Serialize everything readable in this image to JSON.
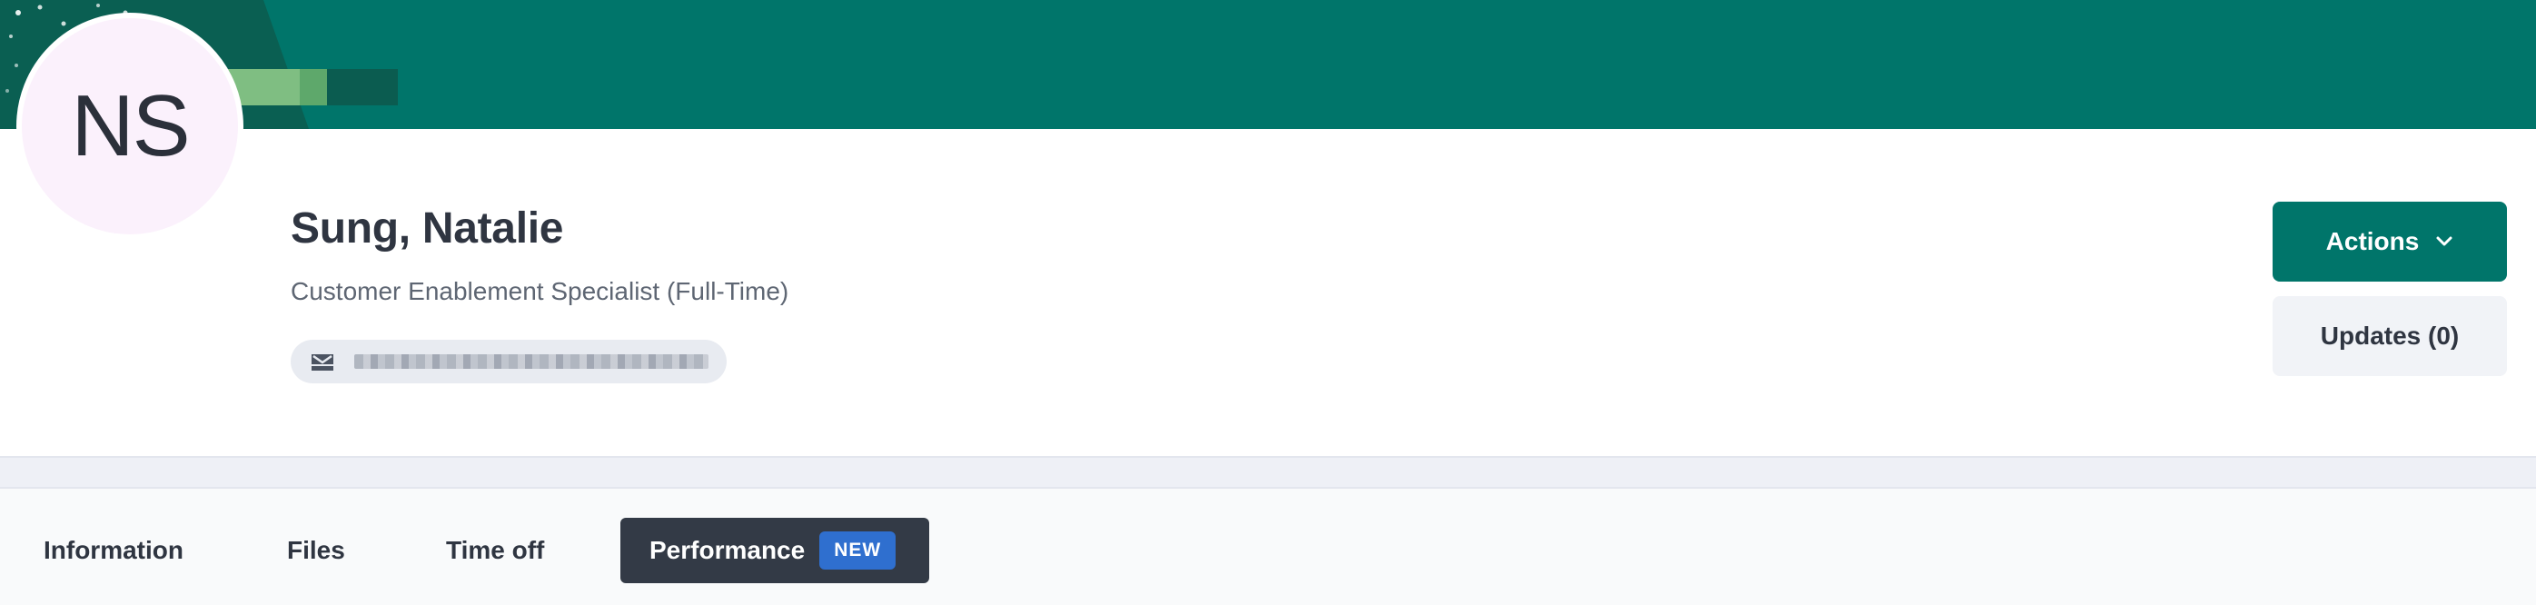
{
  "profile": {
    "initials": "NS",
    "name": "Sung, Natalie",
    "job_title": "Customer Enablement Specialist (Full-Time)",
    "email_icon": "mail-icon"
  },
  "header_actions": {
    "actions_label": "Actions",
    "actions_icon": "chevron-down-icon",
    "updates_label": "Updates (0)"
  },
  "tabs": [
    {
      "label": "Information",
      "active": false
    },
    {
      "label": "Files",
      "active": false
    },
    {
      "label": "Time off",
      "active": false
    },
    {
      "label": "Performance",
      "active": true,
      "badge": "NEW"
    }
  ],
  "colors": {
    "brand": "#00756a",
    "avatar_bg": "#fbf1fc",
    "active_tab": "#333a46",
    "badge": "#2f6fcf"
  }
}
